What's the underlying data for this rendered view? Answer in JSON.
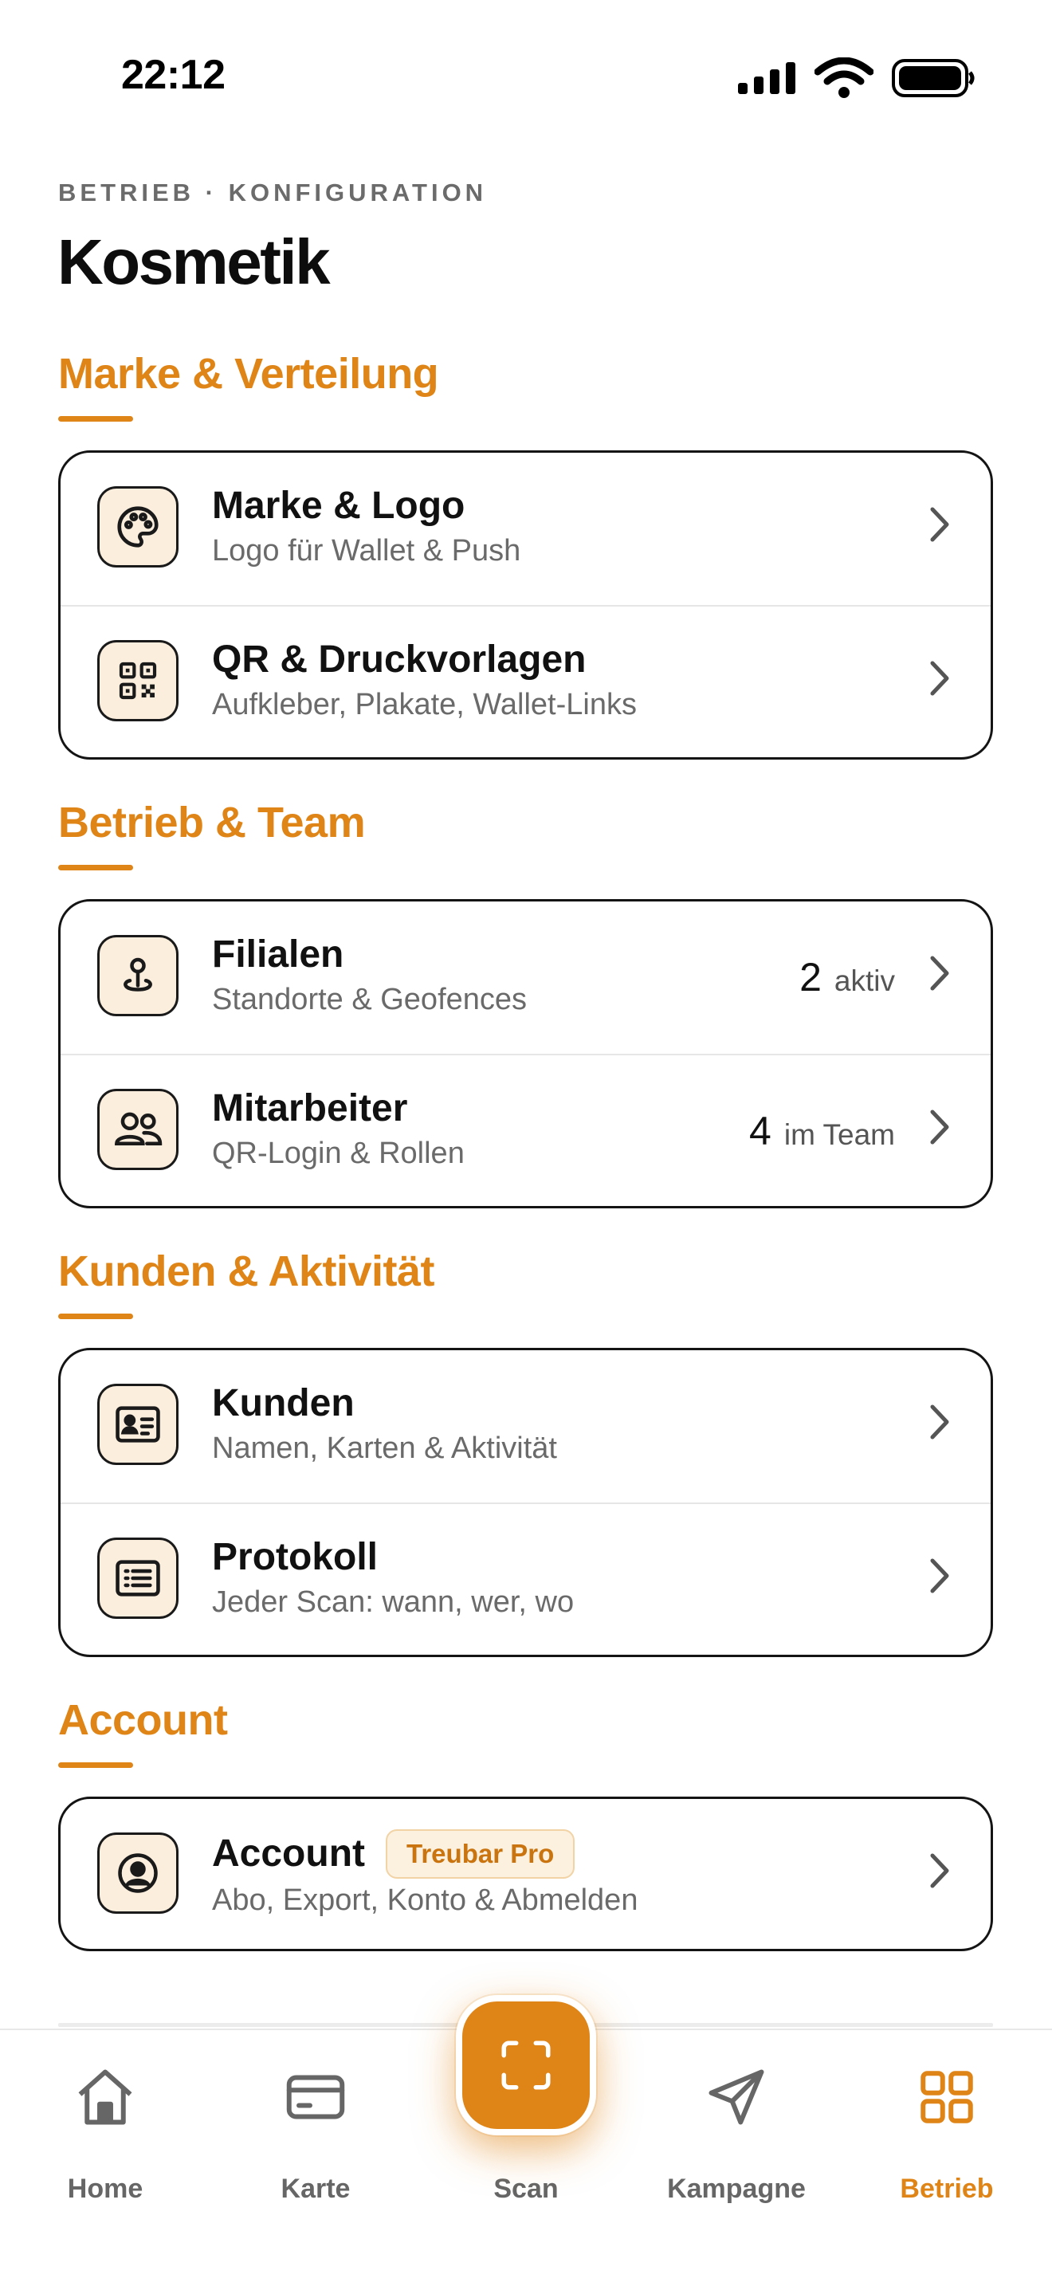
{
  "status_bar": {
    "time": "22:12"
  },
  "header": {
    "eyebrow": "BETRIEB · KONFIGURATION",
    "title": "Kosmetik"
  },
  "sections": [
    {
      "title": "Marke & Verteilung",
      "items": [
        {
          "icon": "palette-icon",
          "title": "Marke & Logo",
          "subtitle": "Logo für Wallet & Push"
        },
        {
          "icon": "qr-code-icon",
          "title": "QR & Druckvorlagen",
          "subtitle": "Aufkleber, Plakate, Wallet-Links"
        }
      ]
    },
    {
      "title": "Betrieb & Team",
      "items": [
        {
          "icon": "map-pin-icon",
          "title": "Filialen",
          "subtitle": "Standorte & Geofences",
          "meta_value": "2",
          "meta_label": "aktiv"
        },
        {
          "icon": "users-icon",
          "title": "Mitarbeiter",
          "subtitle": "QR-Login & Rollen",
          "meta_value": "4",
          "meta_label": "im Team"
        }
      ]
    },
    {
      "title": "Kunden & Aktivität",
      "items": [
        {
          "icon": "id-card-icon",
          "title": "Kunden",
          "subtitle": "Namen, Karten & Aktivität"
        },
        {
          "icon": "log-list-icon",
          "title": "Protokoll",
          "subtitle": "Jeder Scan: wann, wer, wo"
        }
      ]
    },
    {
      "title": "Account",
      "items": [
        {
          "icon": "user-circle-icon",
          "title": "Account",
          "badge": "Treubar Pro",
          "subtitle": "Abo, Export, Konto & Abmelden"
        }
      ]
    }
  ],
  "tabbar": {
    "tabs": [
      {
        "label": "Home",
        "icon": "home-icon",
        "active": false
      },
      {
        "label": "Karte",
        "icon": "card-icon",
        "active": false
      },
      {
        "label": "Scan",
        "icon": "scan-icon",
        "active": false
      },
      {
        "label": "Kampagne",
        "icon": "send-icon",
        "active": false
      },
      {
        "label": "Betrieb",
        "icon": "grid-icon",
        "active": true
      }
    ]
  },
  "colors": {
    "accent": "#df8416",
    "icon_bg": "#fbeedd",
    "text": "#111111",
    "muted": "#6a6a6a"
  }
}
